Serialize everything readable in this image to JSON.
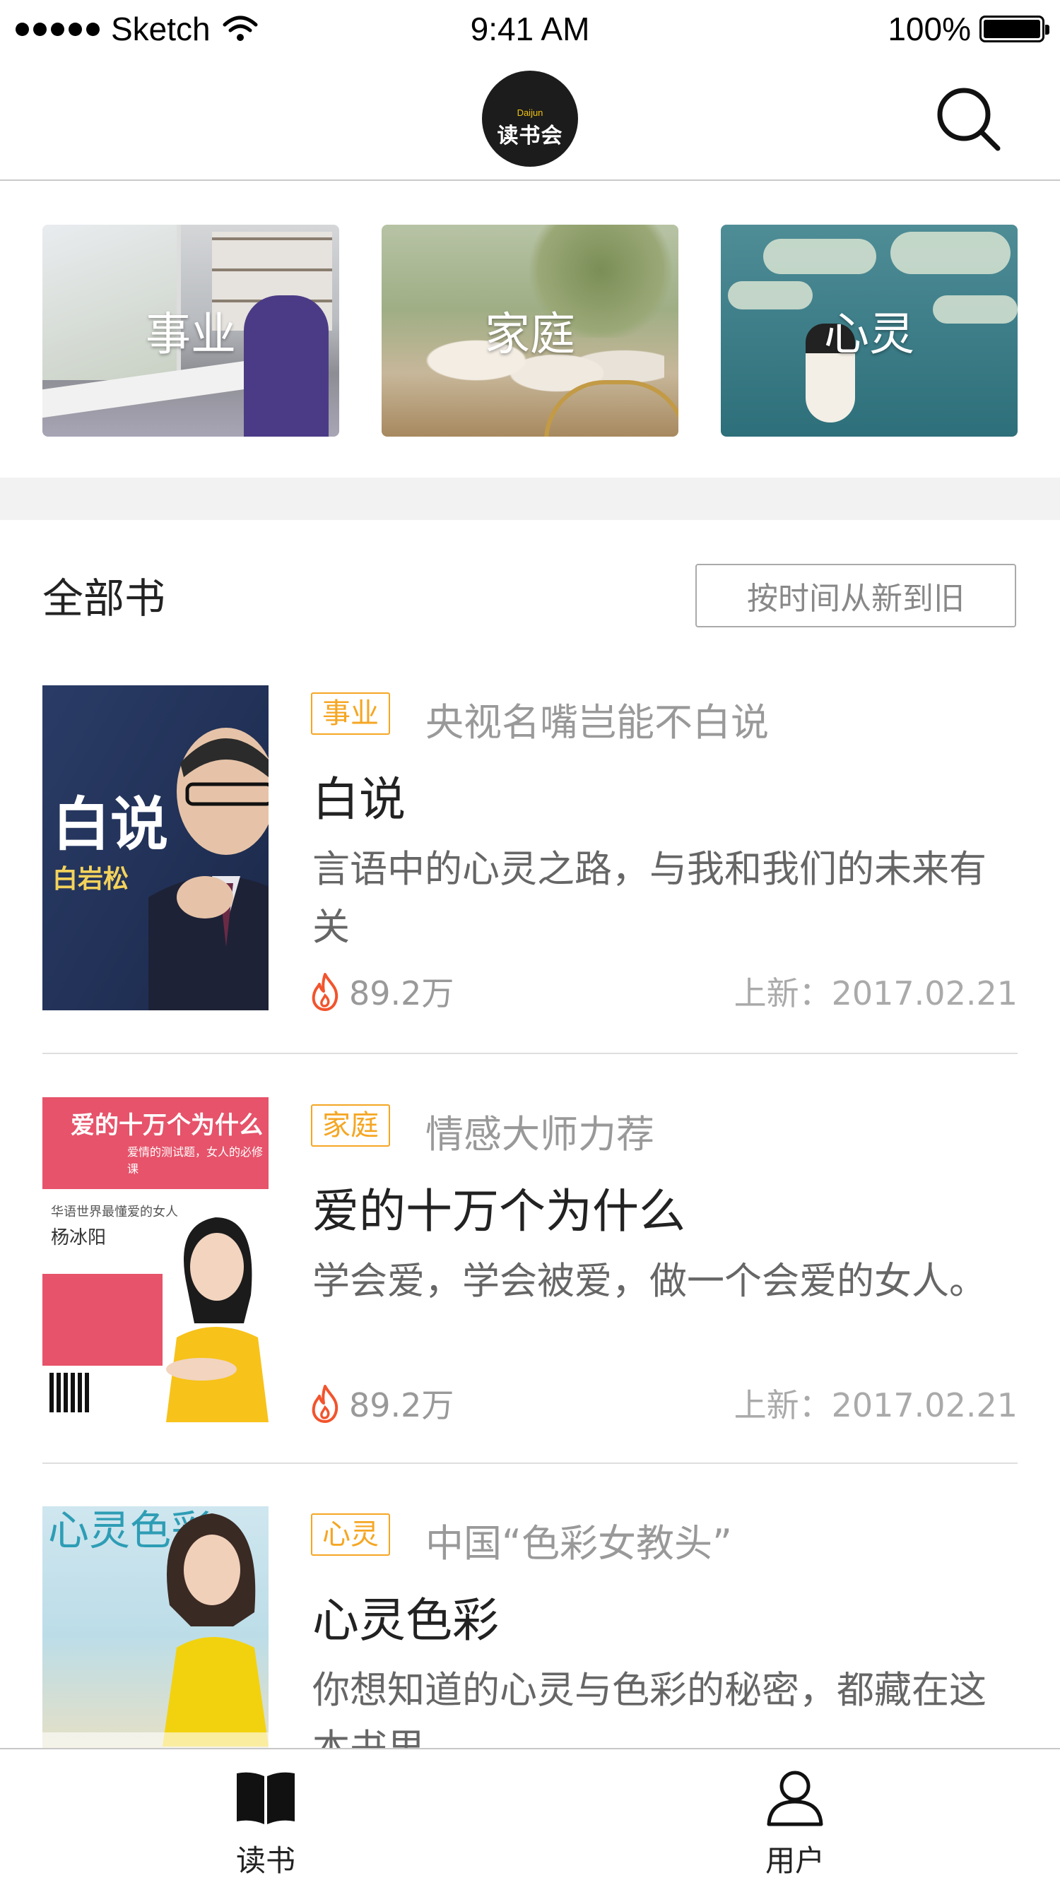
{
  "status_bar": {
    "carrier": "Sketch",
    "time": "9:41 AM",
    "battery": "100%"
  },
  "header": {
    "logo_text": "读书会",
    "logo_small": "Daijun",
    "search_icon": "search-icon"
  },
  "categories": [
    {
      "label": "事业"
    },
    {
      "label": "家庭"
    },
    {
      "label": "心灵"
    }
  ],
  "section": {
    "title": "全部书",
    "sort_label": "按时间从新到旧"
  },
  "books": [
    {
      "tag": "事业",
      "subtitle": "央视名嘴岂能不白说",
      "title": "白说",
      "description": "言语中的心灵之路，与我和我们的未来有关",
      "hot": "89.2万",
      "date": "上新：2017.02.21",
      "cover": {
        "title": "白说",
        "author": "白岩松"
      }
    },
    {
      "tag": "家庭",
      "subtitle": "情感大师力荐",
      "title": "爱的十万个为什么",
      "description": "学会爱，学会被爱，做一个会爱的女人。",
      "hot": "89.2万",
      "date": "上新：2017.02.21",
      "cover": {
        "title": "爱的十万个为什么",
        "tagline": "爱情的测试题，女人的必修课",
        "intro": "华语世界最懂爱的女人",
        "author": "杨冰阳"
      }
    },
    {
      "tag": "心灵",
      "subtitle": "中国“色彩女教头”",
      "title": "心灵色彩",
      "description": "你想知道的心灵与色彩的秘密，都藏在这本书里",
      "hot": "",
      "date": "",
      "cover": {
        "title": "心灵色彩"
      }
    }
  ],
  "tabbar": {
    "read_label": "读书",
    "user_label": "用户"
  },
  "colors": {
    "accent": "#f5a623",
    "hot": "#f2542d",
    "divider": "#dedede"
  }
}
